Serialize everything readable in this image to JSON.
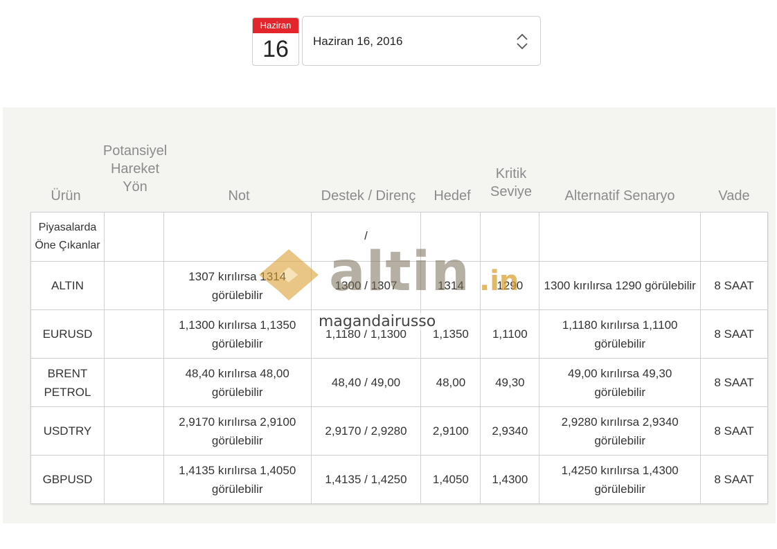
{
  "date_picker": {
    "month": "Haziran",
    "day": "16",
    "value": "Haziran 16, 2016"
  },
  "table": {
    "headers": {
      "product": "Ürün",
      "direction": "Potansiyel Hareket Yön",
      "note": "Not",
      "support": "Destek / Direnç",
      "target": "Hedef",
      "critical": "Kritik Seviye",
      "alt": "Alternatif Senaryo",
      "term": "Vade"
    },
    "rows": [
      {
        "product": "Piyasalarda Öne Çıkanlar",
        "direction": "",
        "note": "",
        "support": "/",
        "target": "",
        "critical": "",
        "alt": "",
        "term": ""
      },
      {
        "product": "ALTIN",
        "direction": "",
        "note": "1307 kırılırsa 1314 görülebilir",
        "support": "1300 / 1307",
        "target": "1314",
        "critical": "1290",
        "alt": "1300 kırılırsa 1290 görülebilir",
        "term": "8 SAAT"
      },
      {
        "product": "EURUSD",
        "direction": "",
        "note": "1,1300 kırılırsa 1,1350 görülebilir",
        "support": "1,1180 / 1,1300",
        "target": "1,1350",
        "critical": "1,1100",
        "alt": "1,1180 kırılırsa 1,1100 görülebilir",
        "term": "8 SAAT"
      },
      {
        "product": "BRENT PETROL",
        "direction": "",
        "note": "48,40 kırılırsa 48,00 görülebilir",
        "support": "48,40 / 49,00",
        "target": "48,00",
        "critical": "49,30",
        "alt": "49,00 kırılırsa 49,30 görülebilir",
        "term": "8 SAAT"
      },
      {
        "product": "USDTRY",
        "direction": "",
        "note": "2,9170 kırılırsa 2,9100 görülebilir",
        "support": "2,9170 / 2,9280",
        "target": "2,9100",
        "critical": "2,9340",
        "alt": "2,9280 kırılırsa 2,9340 görülebilir",
        "term": "8 SAAT"
      },
      {
        "product": "GBPUSD",
        "direction": "",
        "note": "1,4135 kırılırsa 1,4050 görülebilir",
        "support": "1,4135 / 1,4250",
        "target": "1,4050",
        "critical": "1,4300",
        "alt": "1,4250 kırılırsa 1,4300 görülebilir",
        "term": "8 SAAT"
      }
    ]
  },
  "watermark": {
    "brand": "altin",
    "tld": ".in",
    "overlay": "magandairusso"
  }
}
